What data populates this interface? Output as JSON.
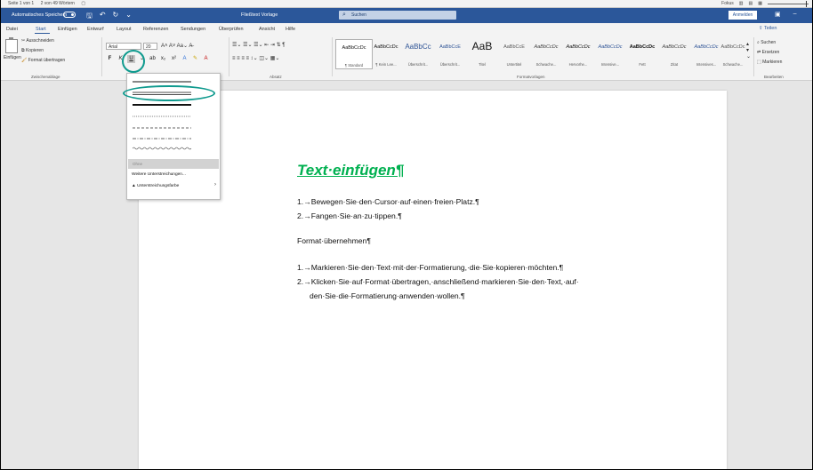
{
  "statusbar": {
    "page": "Seite 1 von 1",
    "words": "2 von 49 Wörtern",
    "focus": "Fokus"
  },
  "titlebar": {
    "autosave": "Automatisches Speichern",
    "document": "Fließtext Vorlage",
    "search_placeholder": "Suchen",
    "signin": "Anmelden"
  },
  "tabs": [
    "Datei",
    "Start",
    "Einfügen",
    "Entwurf",
    "Layout",
    "Referenzen",
    "Sendungen",
    "Überprüfen",
    "Ansicht",
    "Hilfe"
  ],
  "share_label": "Teilen",
  "ribbon": {
    "clipboard": {
      "paste": "Einfügen",
      "cut": "Ausschneiden",
      "copy": "Kopieren",
      "format_painter": "Format übertragen",
      "group_label": "Zwischenablage"
    },
    "font": {
      "name": "Arial",
      "size": "20"
    },
    "paragraph_label": "Absatz",
    "styles": [
      {
        "preview": "AaBbCcDc",
        "name": "¶ Standard"
      },
      {
        "preview": "AaBbCcDc",
        "name": "¶ Kein Lee..."
      },
      {
        "preview": "AaBbCc",
        "name": "Überschrit..."
      },
      {
        "preview": "AaBbCcE",
        "name": "Überschrit..."
      },
      {
        "preview": "AaB",
        "name": "Titel"
      },
      {
        "preview": "AaBbCcE",
        "name": "Untertitel"
      },
      {
        "preview": "AaBbCcDc",
        "name": "Schwache..."
      },
      {
        "preview": "AaBbCcDc",
        "name": "Hervorhe..."
      },
      {
        "preview": "AaBbCcDc",
        "name": "Intensive..."
      },
      {
        "preview": "AaBbCcDc",
        "name": "Fett"
      },
      {
        "preview": "AaBbCcDc",
        "name": "Zitat"
      },
      {
        "preview": "AaBbCcDc",
        "name": "Intensives..."
      },
      {
        "preview": "AaBbCcDc",
        "name": "Schwache..."
      },
      {
        "preview": "AaBbCcDc",
        "name": ""
      }
    ],
    "styles_label": "Formatvorlagen",
    "editing": {
      "find": "Suchen",
      "replace": "Ersetzen",
      "select": "Markieren",
      "group_label": "Bearbeiten"
    }
  },
  "underline_menu": {
    "none_label": "Ohne",
    "more": "Weitere Unterstreichungen...",
    "color": "Unterstreichungsfarbe"
  },
  "document": {
    "title": "Text·einfügen¶",
    "steps1": [
      "1.→Bewegen·Sie·den·Cursor·auf·einen·freien·Platz.¶",
      "2.→Fangen·Sie·an·zu·tippen.¶"
    ],
    "heading2": "Format·übernehmen¶",
    "steps2": [
      "1.→Markieren·Sie·den·Text·mit·der·Formatierung,·die·Sie·kopieren·möchten.¶",
      "2.→Klicken·Sie·auf·Format·übertragen,·anschließend·markieren·Sie·den·Text,·auf·",
      "den·Sie·die·Formatierung·anwenden·wollen.¶"
    ]
  },
  "colors": {
    "brand": "#2b579a",
    "title_green": "#00b050",
    "annotation": "#0f9a8e"
  }
}
